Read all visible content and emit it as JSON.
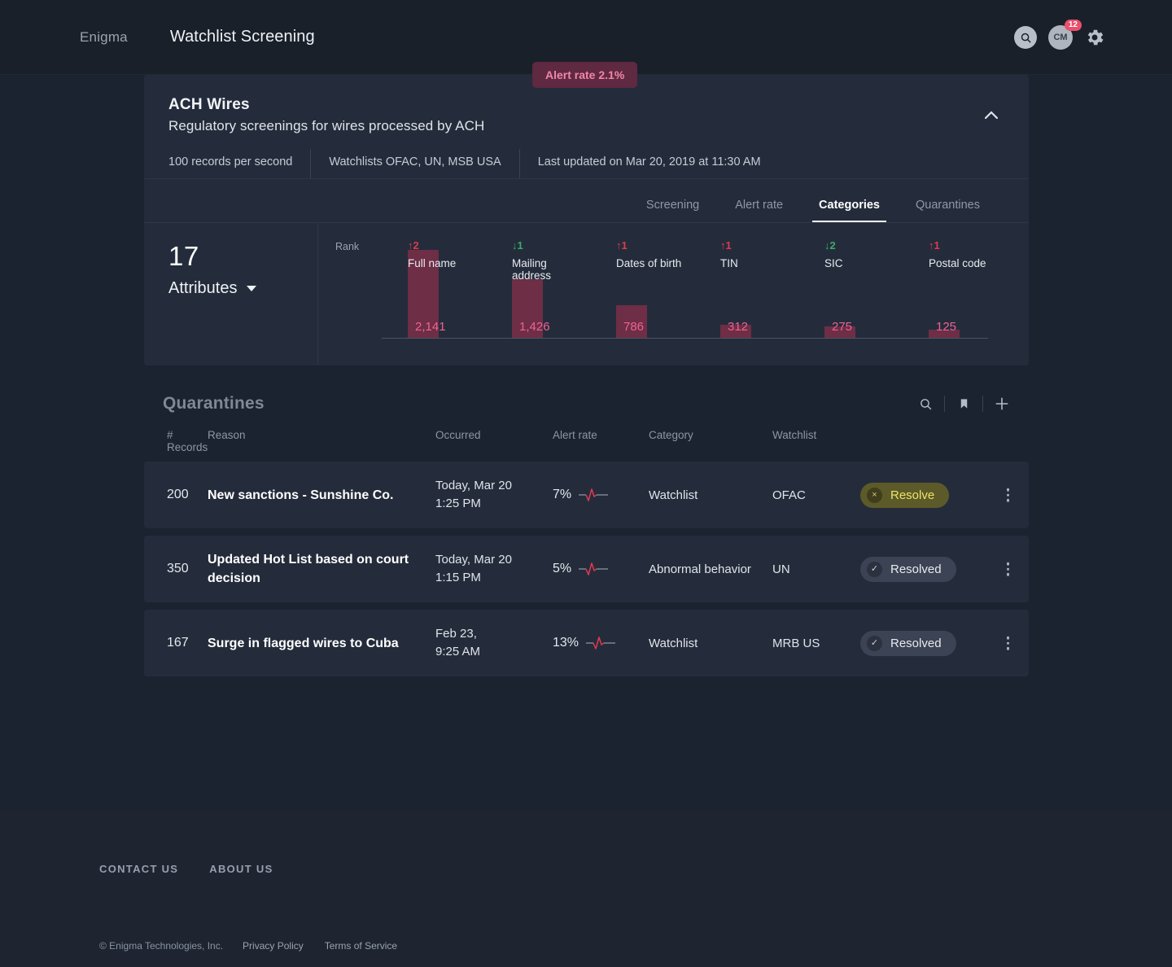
{
  "topbar": {
    "brand": "Enigma",
    "app_title": "Watchlist Screening",
    "search_icon": "search-icon",
    "avatar_initials": "CM",
    "notification_count": "12",
    "settings_icon": "gear-icon"
  },
  "alert_pill": {
    "label": "Alert rate 2.1%"
  },
  "card": {
    "title": "ACH Wires",
    "subtitle": "Regulatory screenings for wires processed by ACH",
    "collapse_icon": "chevron-up-icon",
    "meta": [
      "100 records per second",
      "Watchlists OFAC, UN, MSB USA",
      "Last updated on Mar 20, 2019 at 11:30 AM"
    ],
    "tabs": [
      {
        "label": "Screening",
        "active": false
      },
      {
        "label": "Alert rate",
        "active": false
      },
      {
        "label": "Categories",
        "active": true
      },
      {
        "label": "Quarantines",
        "active": false
      }
    ],
    "attributes": {
      "count": "17",
      "label": "Attributes"
    }
  },
  "chart_data": {
    "type": "bar",
    "title": "Categories",
    "rank_label": "Rank",
    "categories": [
      "Full name",
      "Mailing address",
      "Dates of birth",
      "TIN",
      "SIC",
      "Postal code"
    ],
    "values": [
      2141,
      1426,
      786,
      312,
      275,
      125
    ],
    "value_labels": [
      "2,141",
      "1,426",
      "786",
      "312",
      "275",
      "125"
    ],
    "rank_changes": [
      {
        "direction": "up",
        "amount": "2",
        "glyph": "↑"
      },
      {
        "direction": "down",
        "amount": "1",
        "glyph": "↓"
      },
      {
        "direction": "up",
        "amount": "1",
        "glyph": "↑"
      },
      {
        "direction": "up",
        "amount": "1",
        "glyph": "↑"
      },
      {
        "direction": "down",
        "amount": "2",
        "glyph": "↓"
      },
      {
        "direction": "up",
        "amount": "1",
        "glyph": "↑"
      }
    ],
    "bar_color": "#6d2e46",
    "label_color": "#f06292",
    "up_color": "#e03a4e",
    "down_color": "#3fa96a",
    "ylim": [
      0,
      2400
    ],
    "grid": false,
    "legend": "none",
    "xlabel": "",
    "ylabel": ""
  },
  "quarantines": {
    "title": "Quarantines",
    "actions": [
      "search-icon",
      "bookmark-icon",
      "plus-icon"
    ],
    "columns": [
      "# Records",
      "Reason",
      "Occurred",
      "Alert rate",
      "Category",
      "Watchlist"
    ],
    "rows": [
      {
        "records": "200",
        "reason": "New sanctions - Sunshine Co.",
        "occurred_day": "Today, Mar 20",
        "occurred_time": "1:25 PM",
        "alert_rate": "7%",
        "category": "Watchlist",
        "watchlist": "OFAC",
        "action_label": "Resolve",
        "action_state": "unresolved",
        "action_icon": "×"
      },
      {
        "records": "350",
        "reason": "Updated Hot List based on court decision",
        "occurred_day": "Today, Mar 20",
        "occurred_time": "1:15 PM",
        "alert_rate": "5%",
        "category": "Abnormal behavior",
        "watchlist": "UN",
        "action_label": "Resolved",
        "action_state": "resolved",
        "action_icon": "✓"
      },
      {
        "records": "167",
        "reason": "Surge in flagged wires to Cuba",
        "occurred_day": "Feb 23,",
        "occurred_time": "9:25 AM",
        "alert_rate": "13%",
        "category": "Watchlist",
        "watchlist": "MRB US",
        "action_label": "Resolved",
        "action_state": "resolved",
        "action_icon": "✓"
      }
    ]
  },
  "footer": {
    "links": [
      "CONTACT US",
      "ABOUT US"
    ],
    "copyright": "© Enigma Technologies, Inc.",
    "legal": [
      "Privacy Policy",
      "Terms of Service"
    ]
  }
}
